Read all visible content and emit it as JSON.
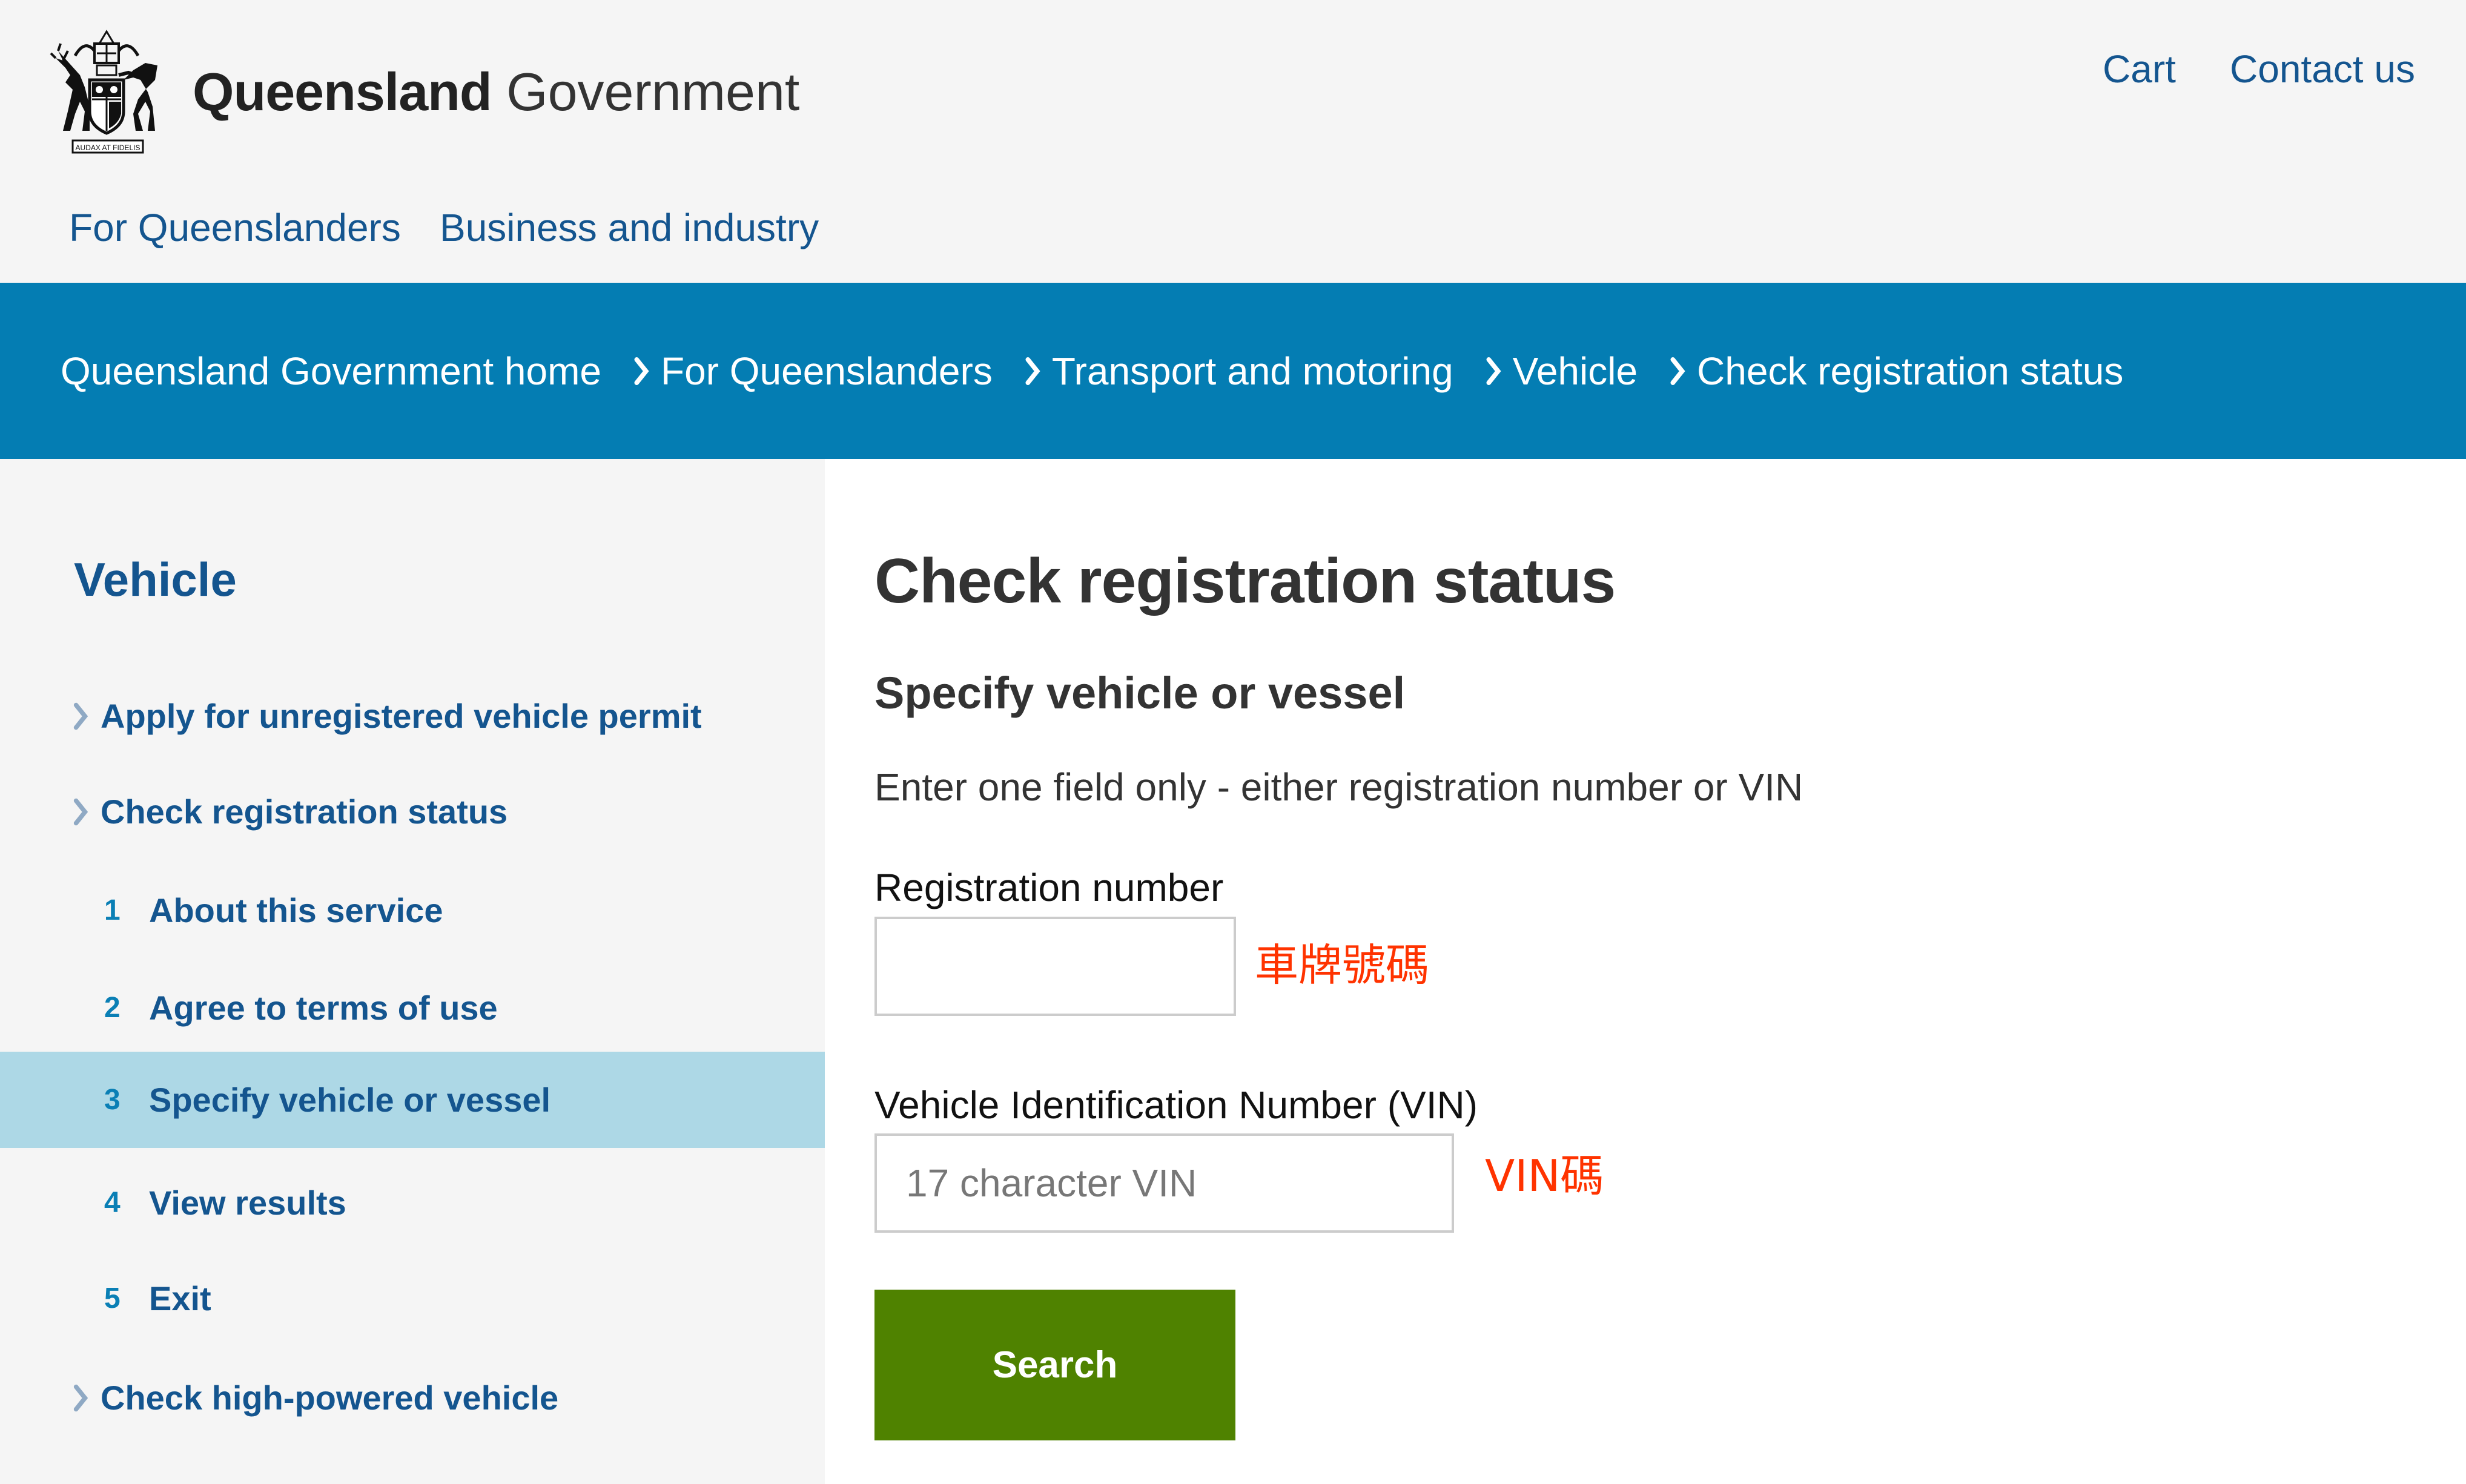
{
  "header": {
    "brand_bold": "Queensland",
    "brand_light": "Government",
    "crest_motto": "AUDAX AT FIDELIS",
    "utility_links": [
      "Cart",
      "Contact us"
    ],
    "nav_links": [
      "For Queenslanders",
      "Business and industry"
    ]
  },
  "breadcrumb": [
    "Queensland Government home",
    "For Queenslanders",
    "Transport and motoring",
    "Vehicle",
    "Check registration status"
  ],
  "sidebar": {
    "title": "Vehicle",
    "items": [
      {
        "type": "link",
        "label": "Apply for unregistered vehicle permit"
      },
      {
        "type": "link",
        "label": "Check registration status"
      },
      {
        "type": "step",
        "number": "1",
        "label": "About this service"
      },
      {
        "type": "step",
        "number": "2",
        "label": "Agree to terms of use"
      },
      {
        "type": "step",
        "number": "3",
        "label": "Specify vehicle or vessel",
        "active": true
      },
      {
        "type": "step",
        "number": "4",
        "label": "View results"
      },
      {
        "type": "step",
        "number": "5",
        "label": "Exit"
      },
      {
        "type": "link",
        "label": "Check high-powered vehicle"
      }
    ]
  },
  "main": {
    "title": "Check registration status",
    "subtitle": "Specify vehicle or vessel",
    "intro": "Enter one field only - either registration number or VIN",
    "registration": {
      "label": "Registration number",
      "value": "",
      "placeholder": "",
      "annotation": "車牌號碼"
    },
    "vin": {
      "label": "Vehicle Identification Number (VIN)",
      "value": "",
      "placeholder": "17 character VIN",
      "annotation": "VIN碼"
    },
    "search_label": "Search"
  },
  "colors": {
    "brand_blue": "#14558f",
    "band_blue": "#047db3",
    "active_bg": "#add8e6",
    "button_green": "#4f8200",
    "annotation_red": "#ff3300"
  }
}
